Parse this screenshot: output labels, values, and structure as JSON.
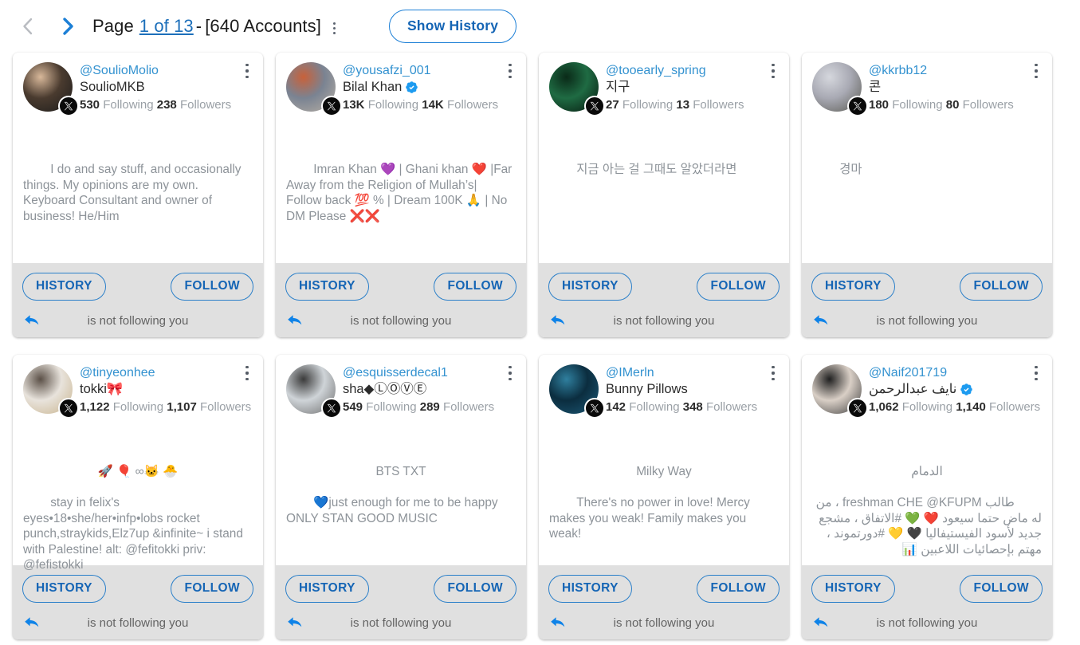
{
  "header": {
    "prev_icon": "chevron-left-icon",
    "next_icon": "chevron-right-icon",
    "page_word": "Page",
    "page_link": "1 of 13",
    "dash": "-",
    "accounts": "[640 Accounts]",
    "show_history_label": "Show History"
  },
  "card_labels": {
    "history": "HISTORY",
    "follow": "FOLLOW",
    "status": "is not following you",
    "following_word": "Following",
    "followers_word": "Followers"
  },
  "colors": {
    "accent": "#1c7fd6",
    "handle": "#3392d0",
    "bio": "#8d9399",
    "footer_bg": "#e0e0e0",
    "verified": "#1d9bf0"
  },
  "accounts": [
    {
      "handle": "@SoulioMolio",
      "name": "SoulioMKB",
      "verified": false,
      "following": "530",
      "followers": "238",
      "bio": "I do and say stuff, and occasionally things. My opinions are my own. Keyboard Consultant and owner of business! He/Him",
      "bio_head": "",
      "align": "left",
      "avatar_colors": [
        "#1b1b1b",
        "#4a3b2f",
        "#d8b89a"
      ],
      "status": "is not following you"
    },
    {
      "handle": "@yousafzi_001",
      "name": "Bilal Khan",
      "verified": true,
      "following": "13K",
      "followers": "14K",
      "bio": "Imran Khan 💜 | Ghani khan ❤️ |Far Away from the Religion of Mullah’s| Follow back 💯 % | Dream 100K 🙏 | No DM Please ❌❌",
      "bio_head": "",
      "align": "left",
      "avatar_colors": [
        "#b9b0a4",
        "#7a8392",
        "#c8613a"
      ],
      "status": "is not following you"
    },
    {
      "handle": "@tooearly_spring",
      "name": "지구",
      "verified": false,
      "following": "27",
      "followers": "13",
      "bio": "지금 아는 걸 그때도 알았더라면",
      "bio_head": "",
      "align": "left",
      "avatar_colors": [
        "#05150c",
        "#1f6b43",
        "#0a2a18"
      ],
      "status": "is not following you"
    },
    {
      "handle": "@kkrbb12",
      "name": "콘",
      "verified": false,
      "following": "180",
      "followers": "80",
      "bio": "경마",
      "bio_head": "",
      "align": "left",
      "avatar_colors": [
        "#5a5a52",
        "#a9aab4",
        "#d5d7dd"
      ],
      "status": "is not following you"
    },
    {
      "handle": "@tinyeonhee",
      "name": "tokki🎀",
      "verified": false,
      "following": "1,122",
      "followers": "1,107",
      "bio": "stay in felix's eyes•18•she/her•infp•lobs rocket punch,straykids,Elz7up &infinite~ i stand with Palestine! alt: @fefitokki priv: @fefistokki",
      "bio_head": "🚀 🎈 ∞🐱 🐣",
      "align": "left",
      "avatar_colors": [
        "#c8b38c",
        "#e8e3dc",
        "#5b5047"
      ],
      "status": "is not following you"
    },
    {
      "handle": "@esquisserdecal1",
      "name": "sha◆ⓁⓄⓋⒺ",
      "verified": false,
      "following": "549",
      "followers": "289",
      "bio": "💙just enough for me to be happy ONLY STAN GOOD MUSIC",
      "bio_head": "BTS TXT",
      "align": "left",
      "avatar_colors": [
        "#6c6c6c",
        "#cfd4d8",
        "#3b3b3b"
      ],
      "status": "is not following you"
    },
    {
      "handle": "@IMerln",
      "name": "Bunny Pillows",
      "verified": false,
      "following": "142",
      "followers": "348",
      "bio": "There's no power in love! Mercy makes you weak! Family makes you weak!",
      "bio_head": "Milky Way",
      "align": "left",
      "avatar_colors": [
        "#1d5a78",
        "#0b2d3f",
        "#2f7f9e"
      ],
      "status": "is not following you"
    },
    {
      "handle": "@Naif201719",
      "name": "نايف عبدالرحمن",
      "verified": true,
      "following": "1,062",
      "followers": "1,140",
      "bio": "طالب freshman CHE @KFUPM ، من له ماض حتما سيعود ❤️ 💚 #الاتفاق ، مشجع جديد لأسود الفيستيفاليا 🖤 💛 #دورتموند ، مهتم بإحصائيات اللاعبين 📊",
      "bio_head": "الدمام",
      "align": "rtl",
      "avatar_colors": [
        "#3b3b3b",
        "#d9cfc6",
        "#1f1f1f"
      ],
      "status": "is not following you"
    }
  ]
}
